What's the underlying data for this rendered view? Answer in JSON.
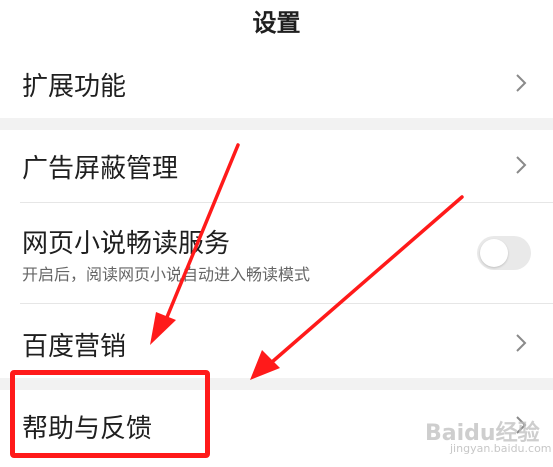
{
  "header": {
    "title": "设置"
  },
  "rows": [
    {
      "label": "扩展功能"
    },
    {
      "label": "广告屏蔽管理"
    },
    {
      "label": "网页小说畅读服务",
      "sublabel": "开启后，阅读网页小说自动进入畅读模式",
      "toggle_on": false
    },
    {
      "label": "百度营销"
    },
    {
      "label": "帮助与反馈"
    }
  ],
  "annotation": {
    "box_color": "#ff1a1a",
    "arrow_color": "#ff1a1a"
  },
  "watermark": {
    "text": "Baidu经验",
    "sub": "jingyan.baidu.com"
  }
}
